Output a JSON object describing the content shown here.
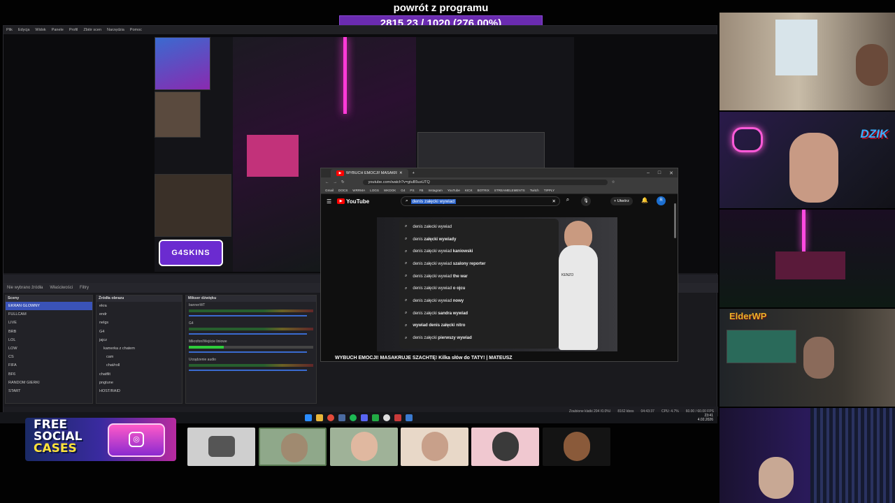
{
  "goal": {
    "title": "powrót z programu",
    "progress_text": "2815.23 / 1020 (276.00%)",
    "progress_fraction": 2.76,
    "bar_color": "#6a2bb0"
  },
  "obs": {
    "menu": [
      "Plik",
      "Edycja",
      "Widok",
      "Panele",
      "Profil",
      "Zbiór scen",
      "Narzędzia",
      "Pomoc"
    ],
    "no_source": "Nie wybrano źródła",
    "props_button": "Właściwości",
    "filters_button": "Filtry",
    "scenes_header": "Sceny",
    "scenes": [
      "EKRAN GLOWNY",
      "FULLCAM",
      "LIVE",
      "BRB",
      "LOL",
      "LOW",
      "CS",
      "FIFA",
      "BF6",
      "RANDOM GIERKI",
      "START"
    ],
    "sources_header": "Źródła obrazu",
    "sources": [
      "ekra",
      "endr",
      "nelgs",
      "G4",
      "jajcz",
      "kamerka z chatem",
      "cam",
      "chat/roll",
      "chatfilt",
      "pngtune",
      "HOST/RAID"
    ],
    "mixer_header": "Mikser dźwięku",
    "mixer_channels": [
      "bannerWT",
      "G4",
      "Mikrofon/Wejście liniowe",
      "Urządzenie audio"
    ],
    "overlay_badge": "G4SKINS",
    "status": [
      "Zgubione klatki 204 (0.0%)",
      "8162 kbps",
      "04:43:37",
      "CPU: 4.7%",
      "60.00 / 60.00 FPS"
    ]
  },
  "chrome": {
    "tab_title": "WYBUCH EMOCJI! MASAKR",
    "url": "youtube.com/watch?v=gtuB5usUTQ",
    "bookmarks": [
      "Gmail",
      "DOCS",
      "WRRMA",
      "LOGS",
      "WKDOK",
      "G4",
      "PS",
      "FB",
      "Instagram",
      "YouTube",
      "KICK",
      "BOTRIX",
      "STREAMELEMENTS",
      "Twitch",
      "TIPPLY"
    ]
  },
  "youtube": {
    "logo": "YouTube",
    "search_value": "denis załęcki wywiad",
    "create_label": "Utwórz",
    "avatar_letter": "R",
    "suggestions": [
      {
        "base": "denis załecki wywiad",
        "bold": ""
      },
      {
        "base": "denis ",
        "bold": "załęcki wywiady"
      },
      {
        "base": "denis załęcki wywiad ",
        "bold": "kaniowski"
      },
      {
        "base": "denis załęcki wywiad ",
        "bold": "szalony reporter"
      },
      {
        "base": "denis załęcki wywiad ",
        "bold": "the war"
      },
      {
        "base": "denis załęcki wywiad ",
        "bold": "o ojcu"
      },
      {
        "base": "denis załęcki wywiad ",
        "bold": "nowy"
      },
      {
        "base": "denis załęcki ",
        "bold": "sandra wywiad"
      },
      {
        "base": "",
        "bold": "wywiad denis załęcki nitro"
      },
      {
        "base": "denis załęcki ",
        "bold": "pierwszy wywiad"
      }
    ],
    "video_title": "WYBUCH EMOCJI! MASAKRUJE SZACHTĘ! Kilka słów do TATY! | MATEUSZ",
    "shirt_text": "KENZO"
  },
  "taskbar": {
    "time": "23:41",
    "date": "4.02.2026"
  },
  "cams": {
    "dzik_label": "DZIK",
    "elder_label": "ElderWP"
  },
  "promo": {
    "line1": "FREE",
    "line2": "SOCIAL",
    "line3": "CASES"
  },
  "colors": {
    "accent_purple": "#6a2bb0",
    "youtube_red": "#ff0000",
    "obs_selected": "#3a53b8"
  }
}
